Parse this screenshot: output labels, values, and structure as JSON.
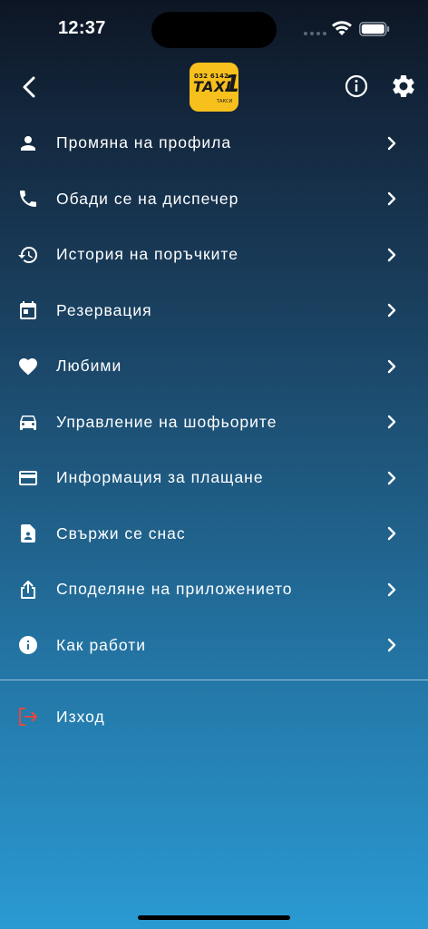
{
  "status_bar": {
    "time": "12:37"
  },
  "header": {
    "logo": {
      "number": "032 6142",
      "word": "TAXI",
      "mark": "1",
      "small": "ТАКСИ"
    }
  },
  "menu": {
    "items": [
      {
        "label": "Промяна на профила",
        "icon": "person-icon"
      },
      {
        "label": "Обади се на диспечер",
        "icon": "phone-icon"
      },
      {
        "label": "История на поръчките",
        "icon": "history-icon"
      },
      {
        "label": "Резервация",
        "icon": "calendar-icon"
      },
      {
        "label": "Любими",
        "icon": "heart-icon"
      },
      {
        "label": "Управление на шофьорите",
        "icon": "car-icon"
      },
      {
        "label": "Информация за плащане",
        "icon": "credit-card-icon"
      },
      {
        "label": "Свържи се снас",
        "icon": "contact-document-icon"
      },
      {
        "label": "Споделяне на приложението",
        "icon": "share-icon"
      },
      {
        "label": "Как работи",
        "icon": "info-icon"
      }
    ]
  },
  "logout": {
    "label": "Изход",
    "color": "#e5483f"
  },
  "colors": {
    "accent": "#f8c01d",
    "text": "#ffffff"
  }
}
